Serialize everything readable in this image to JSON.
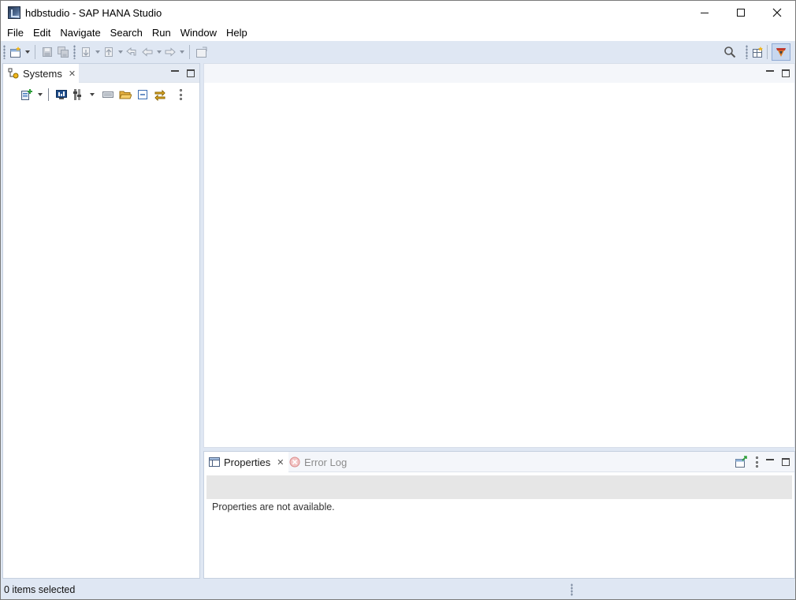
{
  "window": {
    "title": "hdbstudio - SAP HANA Studio"
  },
  "menu": {
    "items": [
      "File",
      "Edit",
      "Navigate",
      "Search",
      "Run",
      "Window",
      "Help"
    ]
  },
  "systems_view": {
    "tab_label": "Systems"
  },
  "editor_area": {},
  "bottom_panel": {
    "tabs": [
      {
        "label": "Properties",
        "active": true
      },
      {
        "label": "Error Log",
        "active": false
      }
    ],
    "message": "Properties are not available."
  },
  "status": {
    "text": "0 items selected"
  },
  "colors": {
    "chrome": "#dfe7f3",
    "panel_border": "#c5d0df",
    "perspective_active": "#c7d7ee"
  },
  "icons": {
    "toolbar": [
      "new-wizard-icon",
      "save-icon",
      "save-all-icon",
      "next-annotation-icon",
      "previous-annotation-icon",
      "last-edit-location-icon",
      "back-icon",
      "forward-icon",
      "open-perspective-icon",
      "search-icon",
      "perspective-icon",
      "active-perspective-icon"
    ],
    "systems_toolbar": [
      "add-system-icon",
      "sql-console-icon",
      "hierarchy-icon",
      "sql-icon",
      "open-folder-icon",
      "collapse-all-icon",
      "link-editor-icon",
      "view-menu-icon"
    ]
  }
}
